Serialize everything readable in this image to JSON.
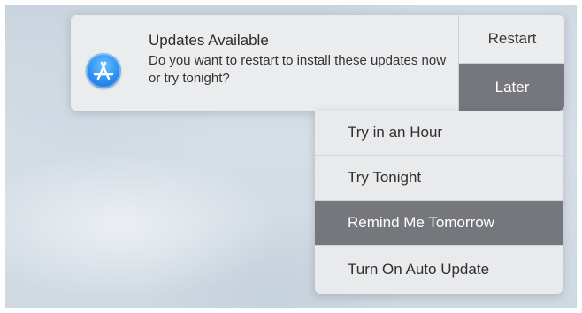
{
  "notification": {
    "title": "Updates Available",
    "message": "Do you want to restart to install these updates now or try tonight?",
    "app_icon": "app-store-icon",
    "actions": {
      "restart_label": "Restart",
      "later_label": "Later"
    }
  },
  "later_menu": {
    "items": [
      {
        "label": "Try in an Hour",
        "selected": false
      },
      {
        "label": "Try Tonight",
        "selected": false
      },
      {
        "label": "Remind Me Tomorrow",
        "selected": true
      },
      {
        "label": "Turn On Auto Update",
        "selected": false
      }
    ]
  },
  "colors": {
    "selected_bg": "#75777d",
    "banner_bg": "#ebecee",
    "icon_blue": "#2a8ef2"
  }
}
